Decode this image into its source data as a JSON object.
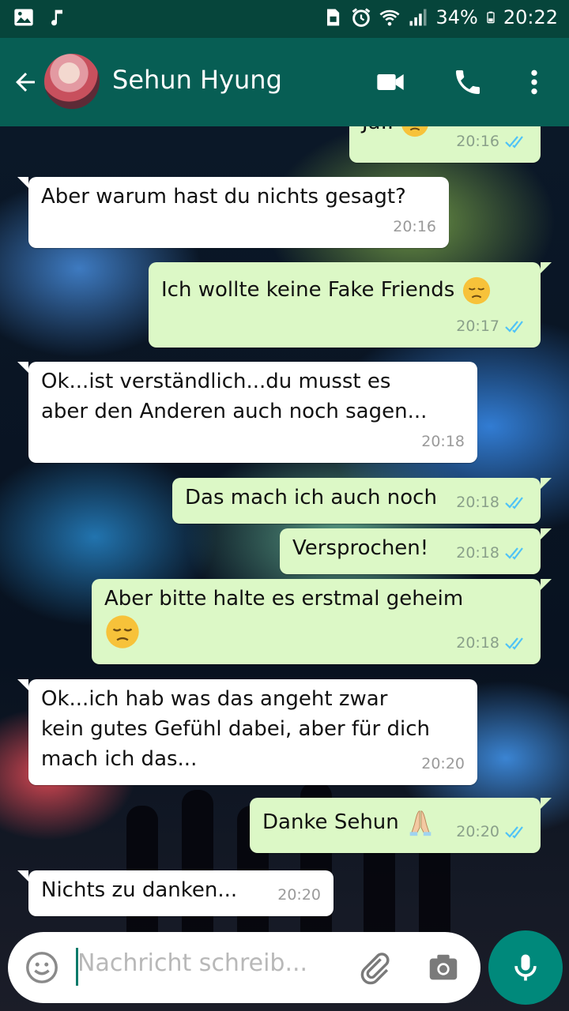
{
  "status_bar": {
    "battery": "34%",
    "time": "20:22",
    "icons": [
      "image-icon",
      "music-note-icon",
      "sim-lock-icon",
      "alarm-icon",
      "wifi-icon",
      "signal-icon",
      "battery-icon"
    ]
  },
  "header": {
    "contact_name": "Sehun Hyung",
    "icons": [
      "back-arrow-icon",
      "video-call-icon",
      "phone-icon",
      "more-vert-icon"
    ]
  },
  "messages": [
    {
      "id": 0,
      "dir": "out",
      "text": "Ja..",
      "emoji": "pensive-face",
      "time": "20:16",
      "read": true
    },
    {
      "id": 1,
      "dir": "in",
      "text": "Aber warum hast du nichts gesagt?",
      "time": "20:16"
    },
    {
      "id": 2,
      "dir": "out",
      "text": "Ich wollte keine Fake Friends",
      "emoji": "pensive-face",
      "time": "20:17",
      "read": true
    },
    {
      "id": 3,
      "dir": "in",
      "line1": "Ok...ist verständlich...du musst es",
      "line2": "aber den Anderen auch noch sagen...",
      "time": "20:18"
    },
    {
      "id": 4,
      "dir": "out",
      "text": "Das mach ich auch noch",
      "time": "20:18",
      "read": true
    },
    {
      "id": 5,
      "dir": "out",
      "text": "Versprochen!",
      "time": "20:18",
      "read": true
    },
    {
      "id": 6,
      "dir": "out",
      "text": "Aber bitte halte es erstmal geheim",
      "emoji": "pensive-face",
      "time": "20:18",
      "read": true
    },
    {
      "id": 7,
      "dir": "in",
      "line1": "Ok...ich hab was das angeht zwar",
      "line2": "kein gutes Gefühl dabei, aber für dich",
      "line3": "mach ich das...",
      "time": "20:20"
    },
    {
      "id": 8,
      "dir": "out",
      "text": "Danke Sehun",
      "emoji": "folded-hands",
      "time": "20:20",
      "read": true
    },
    {
      "id": 9,
      "dir": "in",
      "text": "Nichts zu danken...",
      "time": "20:20"
    }
  ],
  "composer": {
    "placeholder": "Nachricht schreib...",
    "icons": [
      "emoji-icon",
      "attach-icon",
      "camera-icon",
      "mic-icon"
    ]
  },
  "colors": {
    "header": "#075e54",
    "status_bar": "#06453b",
    "outgoing_bubble": "#dcf8c6",
    "incoming_bubble": "#ffffff",
    "read_ticks": "#4fc3f7",
    "mic_button": "#00897b"
  }
}
